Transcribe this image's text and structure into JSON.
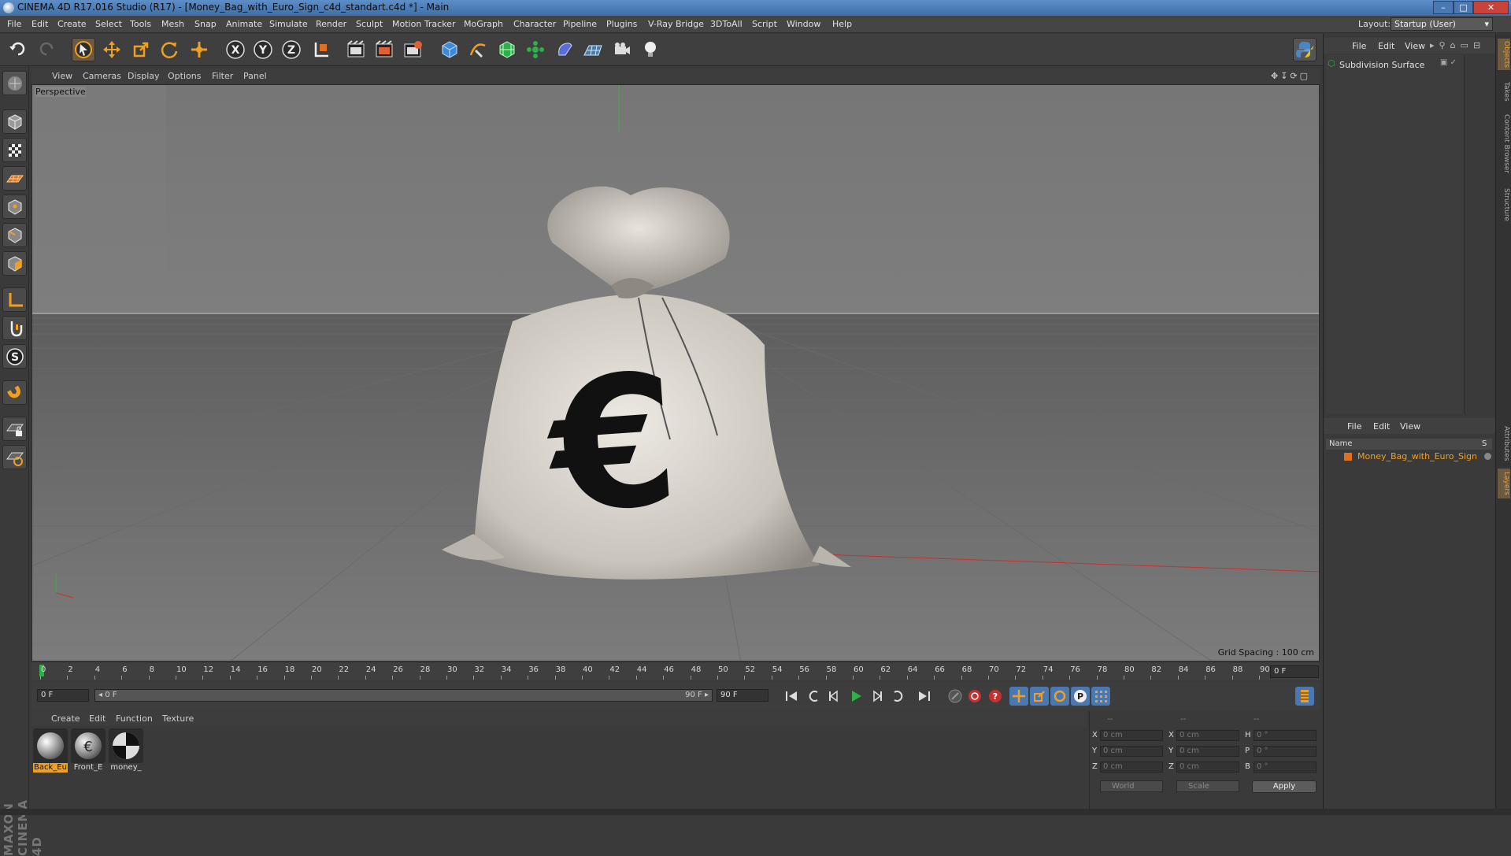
{
  "window": {
    "title": "CINEMA 4D R17.016 Studio (R17) - [Money_Bag_with_Euro_Sign_c4d_standart.c4d *] - Main",
    "minimize": "–",
    "maximize": "□",
    "close": "✕"
  },
  "menu": [
    "File",
    "Edit",
    "Create",
    "Select",
    "Tools",
    "Mesh",
    "Snap",
    "Animate",
    "Simulate",
    "Render",
    "Sculpt",
    "Motion Tracker",
    "MoGraph",
    "Character",
    "Pipeline",
    "Plugins",
    "V-Ray Bridge",
    "3DToAll",
    "Script",
    "Window",
    "Help"
  ],
  "layout": {
    "label": "Layout:",
    "value": "Startup (User)"
  },
  "toolbar_icons": [
    "undo-icon",
    "redo-icon",
    "live-selection-icon",
    "move-icon",
    "scale-icon",
    "rotate-icon",
    "transform-icon",
    "x-axis-icon",
    "y-axis-icon",
    "z-axis-icon",
    "coordinate-system-icon",
    "render-view-icon",
    "render-picture-viewer-icon",
    "edit-render-settings-icon",
    "cube-icon",
    "pen-spline-icon",
    "subdivision-icon",
    "cloner-icon",
    "deformer-icon",
    "floor-icon",
    "camera-icon",
    "light-icon",
    "python-icon"
  ],
  "viewport": {
    "menu": [
      "View",
      "Cameras",
      "Display",
      "Options",
      "Filter",
      "Panel"
    ],
    "label": "Perspective",
    "grid_spacing": "Grid Spacing : 100 cm",
    "euro_symbol": "€"
  },
  "timeline": {
    "ticks": [
      "0",
      "2",
      "4",
      "6",
      "8",
      "10",
      "12",
      "14",
      "16",
      "18",
      "20",
      "22",
      "24",
      "26",
      "28",
      "30",
      "32",
      "34",
      "36",
      "38",
      "40",
      "42",
      "44",
      "46",
      "48",
      "50",
      "52",
      "54",
      "56",
      "58",
      "60",
      "62",
      "64",
      "66",
      "68",
      "70",
      "72",
      "74",
      "76",
      "78",
      "80",
      "82",
      "84",
      "86",
      "88",
      "90"
    ],
    "current_frame": "0 F"
  },
  "transport": {
    "start": "0 F",
    "range_start": "◂ 0 F",
    "range_end": "90 F ▸",
    "end": "90 F"
  },
  "materials": {
    "menu": [
      "Create",
      "Edit",
      "Function",
      "Texture"
    ],
    "items": [
      {
        "label": "Back_Eu",
        "selected": true
      },
      {
        "label": "Front_E",
        "selected": false
      },
      {
        "label": "money_",
        "selected": false
      }
    ]
  },
  "coordinates": {
    "headers": [
      "--",
      "--",
      "--"
    ],
    "rows": [
      {
        "a": "X",
        "av": "0 cm",
        "b": "X",
        "bv": "0 cm",
        "c": "H",
        "cv": "0 °"
      },
      {
        "a": "Y",
        "av": "0 cm",
        "b": "Y",
        "bv": "0 cm",
        "c": "P",
        "cv": "0 °"
      },
      {
        "a": "Z",
        "av": "0 cm",
        "b": "Z",
        "bv": "0 cm",
        "c": "B",
        "cv": "0 °"
      }
    ],
    "mode1": "World",
    "mode2": "Scale",
    "apply": "Apply"
  },
  "objects": {
    "menu": [
      "File",
      "Edit",
      "View"
    ],
    "items": [
      {
        "name": "Subdivision Surface"
      }
    ]
  },
  "layers": {
    "menu": [
      "File",
      "Edit",
      "View"
    ],
    "header": {
      "name": "Name",
      "s": "S"
    },
    "items": [
      {
        "name": "Money_Bag_with_Euro_Sign",
        "color": "#e07020"
      }
    ]
  },
  "side_tabs": {
    "top": [
      "Objects",
      "Takes",
      "Content Browser",
      "Structure"
    ],
    "bottom": [
      "Attributes",
      "Layers"
    ]
  },
  "branding": "MAXON CINEMA 4D",
  "colors": {
    "accent": "#f0a020",
    "x_axis": "#c83030",
    "y_axis": "#30b030"
  }
}
